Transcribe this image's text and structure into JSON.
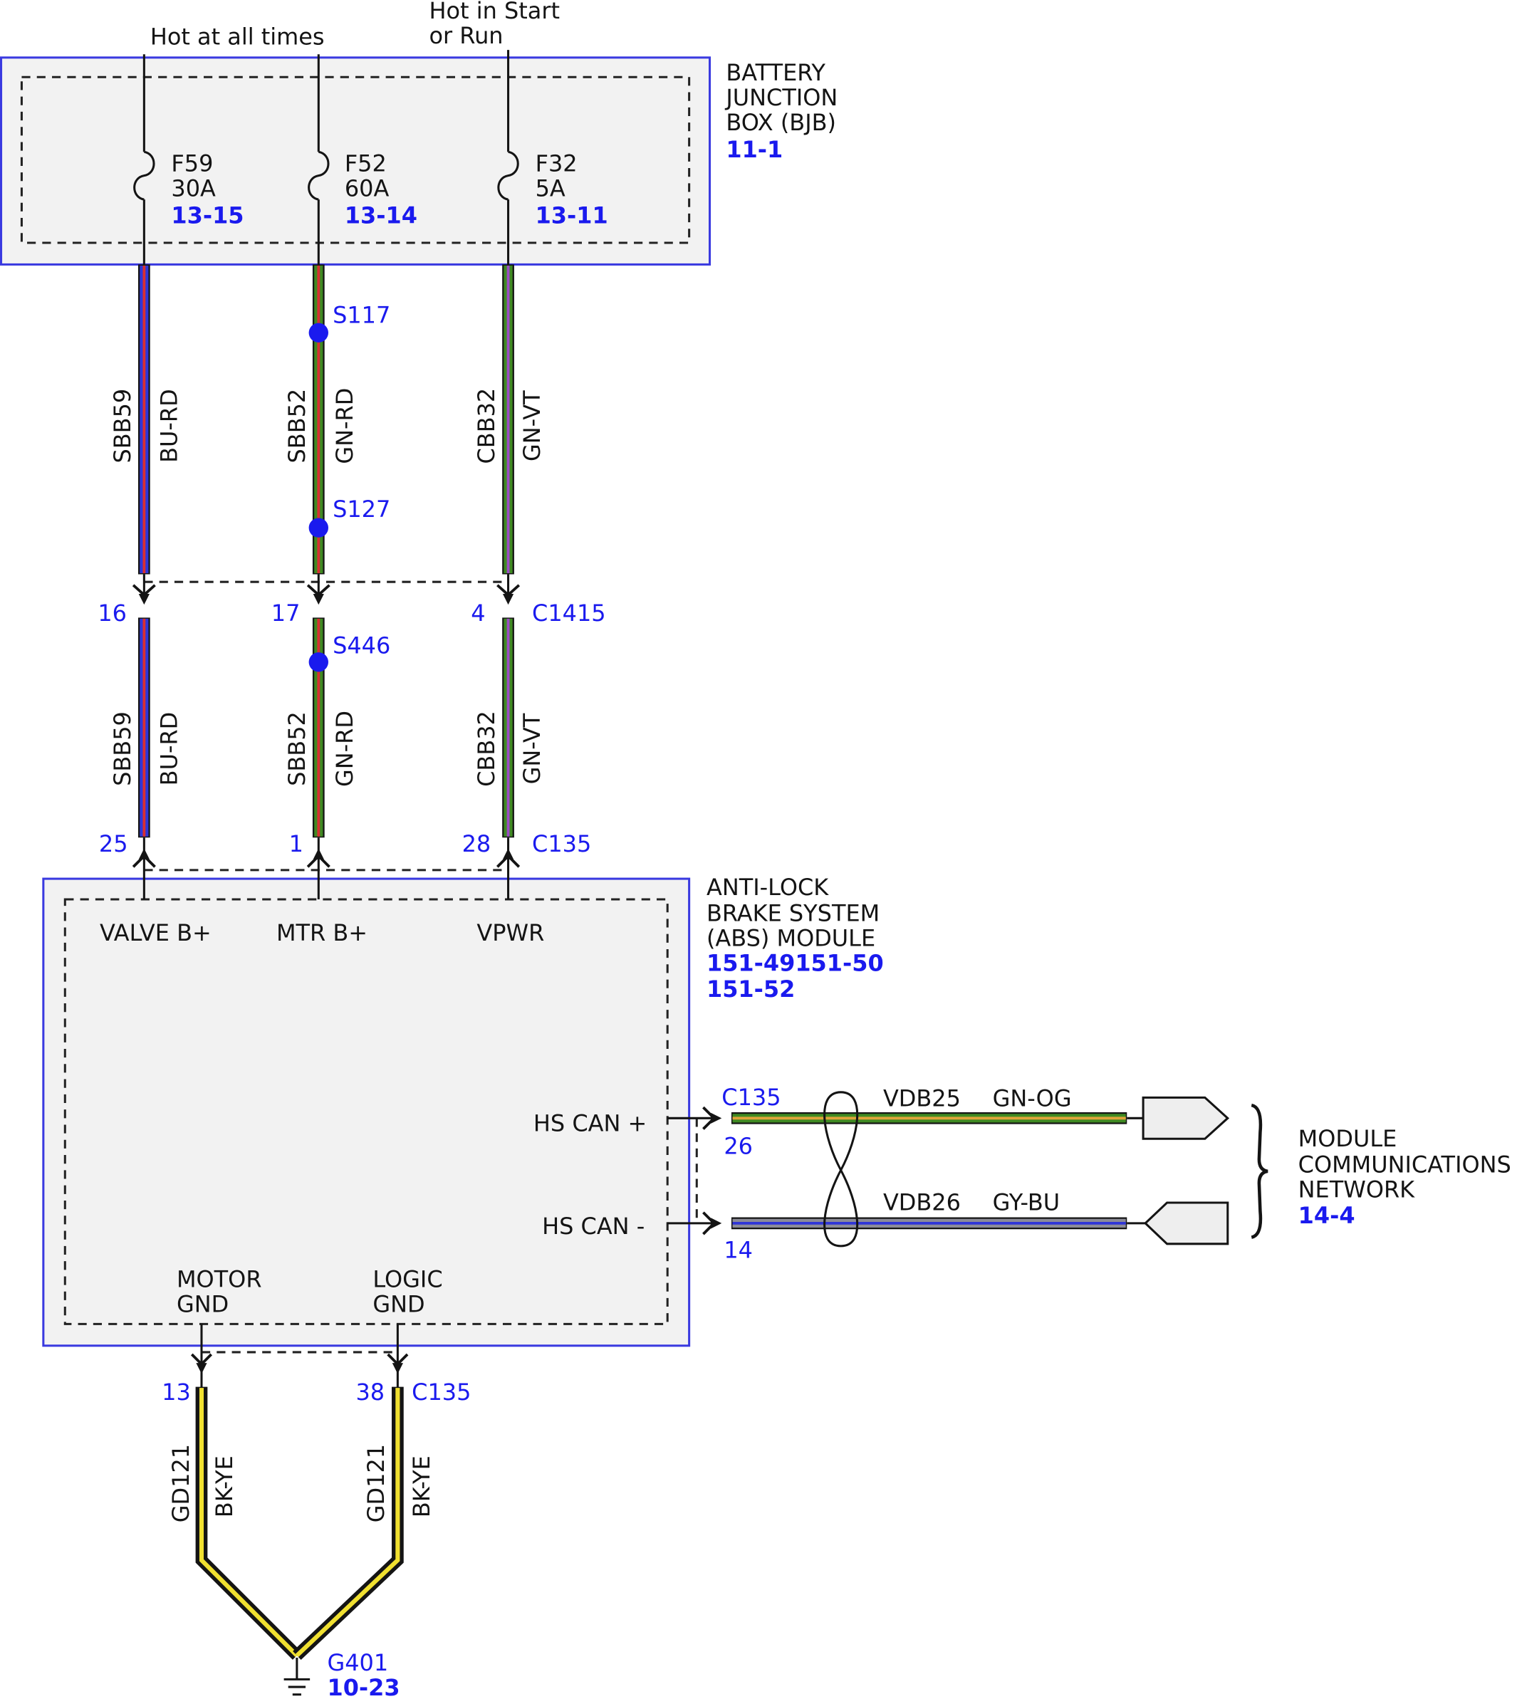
{
  "diagram": {
    "top_labels": {
      "hot_at_all_times": "Hot at all times",
      "hot_in_start": "Hot in Start",
      "or_run": "or Run"
    },
    "bjb": {
      "title_lines": [
        "BATTERY",
        "JUNCTION",
        "BOX (BJB)"
      ],
      "ref": "11-1",
      "fuses": [
        {
          "id": "F59",
          "rating": "30A",
          "ref": "13-15"
        },
        {
          "id": "F52",
          "rating": "60A",
          "ref": "13-14"
        },
        {
          "id": "F32",
          "rating": "5A",
          "ref": "13-11"
        }
      ]
    },
    "upper_wires": [
      {
        "circuit": "SBB59",
        "color_code": "BU-RD"
      },
      {
        "circuit": "SBB52",
        "color_code": "GN-RD"
      },
      {
        "circuit": "CBB32",
        "color_code": "GN-VT"
      }
    ],
    "splices": {
      "s117": "S117",
      "s127": "S127",
      "s446": "S446"
    },
    "c1415": {
      "name": "C1415",
      "pins": [
        "16",
        "17",
        "4"
      ]
    },
    "lower_wires": [
      {
        "circuit": "SBB59",
        "color_code": "BU-RD"
      },
      {
        "circuit": "SBB52",
        "color_code": "GN-RD"
      },
      {
        "circuit": "CBB32",
        "color_code": "GN-VT"
      }
    ],
    "c135_power": {
      "name": "C135",
      "pins": [
        "25",
        "1",
        "28"
      ]
    },
    "abs": {
      "title_lines": [
        "ANTI-LOCK",
        "BRAKE SYSTEM",
        "(ABS) MODULE"
      ],
      "refs": [
        "151-49151-50",
        "151-52"
      ],
      "pins": [
        "VALVE B+",
        "MTR B+",
        "VPWR"
      ],
      "hs_can_plus": "HS CAN +",
      "hs_can_minus": "HS CAN -",
      "motor_gnd": [
        "MOTOR",
        "GND"
      ],
      "logic_gnd": [
        "LOGIC",
        "GND"
      ]
    },
    "can": {
      "connector": "C135",
      "pin_plus": "26",
      "pin_minus": "14",
      "plus_wire": {
        "circuit": "VDB25",
        "color_code": "GN-OG"
      },
      "minus_wire": {
        "circuit": "VDB26",
        "color_code": "GY-BU"
      }
    },
    "network": {
      "title_lines": [
        "MODULE",
        "COMMUNICATIONS",
        "NETWORK"
      ],
      "ref": "14-4"
    },
    "ground": {
      "connector": "C135",
      "pins": [
        "13",
        "38"
      ],
      "wires": [
        {
          "circuit": "GD121",
          "color_code": "BK-YE"
        },
        {
          "circuit": "GD121",
          "color_code": "BK-YE"
        }
      ],
      "ground_point": "G401",
      "ref": "10-23"
    }
  },
  "colors": {
    "ref_blue": "#1a1aee",
    "box_border": "#3a3ae0",
    "box_fill": "#f2f2f2",
    "bu": "#2f35d8",
    "rd": "#d83030",
    "gn": "#3f8a22",
    "vt": "#9b4cc4",
    "og": "#e0a43a",
    "gy": "#8c8c98",
    "bk": "#141414",
    "ye": "#f0e030"
  }
}
